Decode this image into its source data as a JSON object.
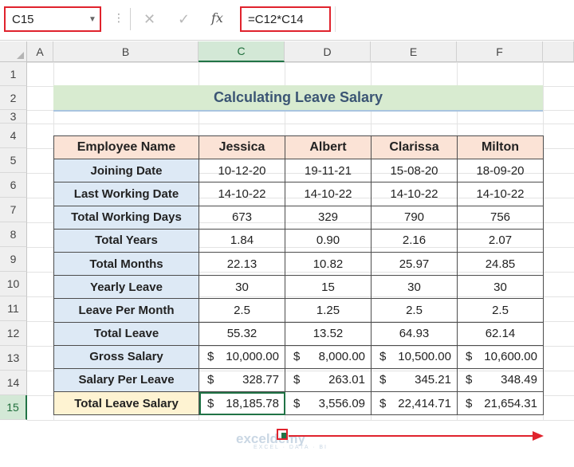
{
  "formula_bar": {
    "name_box": "C15",
    "name_box_arrow": "▼",
    "dots": "⋮",
    "cancel_glyph": "✕",
    "enter_glyph": "✓",
    "fx_glyph": "fx",
    "formula": "=C12*C14"
  },
  "columns": [
    "A",
    "B",
    "C",
    "D",
    "E",
    "F"
  ],
  "rows": [
    "1",
    "2",
    "3",
    "4",
    "5",
    "6",
    "7",
    "8",
    "9",
    "10",
    "11",
    "12",
    "13",
    "14",
    "15"
  ],
  "title": "Calculating Leave Salary",
  "table": {
    "header": [
      "Employee Name",
      "Jessica",
      "Albert",
      "Clarissa",
      "Milton"
    ],
    "rows": [
      {
        "label": "Joining Date",
        "values": [
          "10-12-20",
          "19-11-21",
          "15-08-20",
          "18-09-20"
        ]
      },
      {
        "label": "Last Working Date",
        "values": [
          "14-10-22",
          "14-10-22",
          "14-10-22",
          "14-10-22"
        ]
      },
      {
        "label": "Total Working Days",
        "values": [
          "673",
          "329",
          "790",
          "756"
        ]
      },
      {
        "label": "Total Years",
        "values": [
          "1.84",
          "0.90",
          "2.16",
          "2.07"
        ]
      },
      {
        "label": "Total Months",
        "values": [
          "22.13",
          "10.82",
          "25.97",
          "24.85"
        ]
      },
      {
        "label": "Yearly Leave",
        "values": [
          "30",
          "15",
          "30",
          "30"
        ]
      },
      {
        "label": "Leave Per Month",
        "values": [
          "2.5",
          "1.25",
          "2.5",
          "2.5"
        ]
      },
      {
        "label": "Total Leave",
        "values": [
          "55.32",
          "13.52",
          "64.93",
          "62.14"
        ]
      }
    ],
    "money_rows": [
      {
        "label": "Gross Salary",
        "values": [
          "10,000.00",
          "8,000.00",
          "10,500.00",
          "10,600.00"
        ]
      },
      {
        "label": "Salary Per Leave",
        "values": [
          "328.77",
          "263.01",
          "345.21",
          "348.49"
        ]
      },
      {
        "label": "Total Leave Salary",
        "values": [
          "18,185.78",
          "3,556.09",
          "22,414.71",
          "21,654.31"
        ]
      }
    ],
    "currency": "$"
  },
  "watermark": {
    "brand": "exceldemy",
    "tagline": "EXCEL · DATA · BI"
  },
  "colors": {
    "accent_red": "#e0232d",
    "excel_green": "#217346",
    "header_fill": "#fbe3d6",
    "label_fill": "#dde9f5",
    "title_fill": "#d8ebd0",
    "total_fill": "#fef3d2"
  }
}
